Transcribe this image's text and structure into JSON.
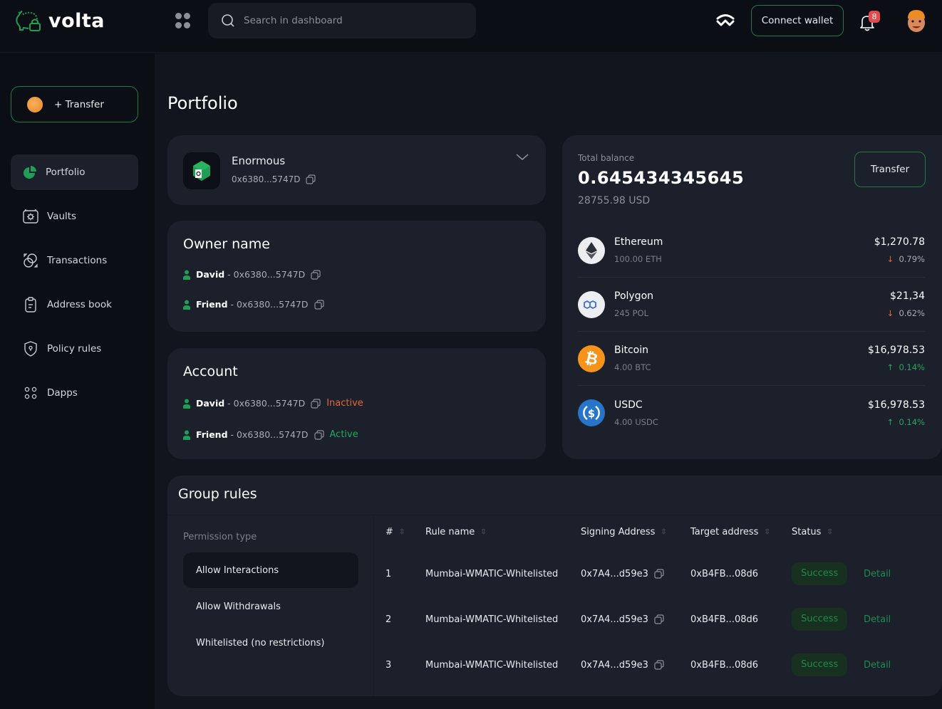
{
  "app": {
    "name": "volta"
  },
  "topbar": {
    "search_placeholder": "Search in dashboard",
    "connect_wallet_label": "Connect wallet",
    "notification_count": "8"
  },
  "sidebar": {
    "transfer_label": "+ Transfer",
    "items": [
      {
        "label": "Portfolio",
        "icon": "pie-chart-icon",
        "active": true
      },
      {
        "label": "Vaults",
        "icon": "vault-icon",
        "active": false
      },
      {
        "label": "Transactions",
        "icon": "transactions-icon",
        "active": false
      },
      {
        "label": "Address book",
        "icon": "clipboard-icon",
        "active": false
      },
      {
        "label": "Policy rules",
        "icon": "shield-icon",
        "active": false
      },
      {
        "label": "Dapps",
        "icon": "dots-grid-icon",
        "active": false
      }
    ]
  },
  "main": {
    "page_title": "Portfolio",
    "vault": {
      "name": "Enormous",
      "address": "0x6380...5747D"
    },
    "owners": {
      "title": "Owner name",
      "members": [
        {
          "name": "David",
          "address": "0x6380...5747D"
        },
        {
          "name": "Friend",
          "address": "0x6380...5747D"
        }
      ]
    },
    "account": {
      "title": "Account",
      "members": [
        {
          "name": "David",
          "address": "0x6380...5747D",
          "status": "Inactive"
        },
        {
          "name": "Friend",
          "address": "0x6380...5747D",
          "status": "Active"
        }
      ]
    },
    "balance": {
      "label": "Total balance",
      "value": "0.645434345645",
      "usd": "28755.98 USD",
      "transfer_label": "Transfer",
      "assets": [
        {
          "name": "Ethereum",
          "amount": "100.00 ETH",
          "usd": "$1,270.78",
          "change": "0.79%",
          "direction": "down",
          "icon": "ethereum-icon",
          "color": "#eceef2"
        },
        {
          "name": "Polygon",
          "amount": "245 POL",
          "usd": "$21,34",
          "change": "0.62%",
          "direction": "down",
          "icon": "polygon-icon",
          "color": "#eceef2"
        },
        {
          "name": "Bitcoin",
          "amount": "4.00 BTC",
          "usd": "$16,978.53",
          "change": "0.14%",
          "direction": "up",
          "icon": "bitcoin-icon",
          "color": "#f7931a"
        },
        {
          "name": "USDC",
          "amount": "4.00 USDC",
          "usd": "$16,978.53",
          "change": "0.14%",
          "direction": "up",
          "icon": "usdc-icon",
          "color": "#2775ca"
        }
      ]
    },
    "group_rules": {
      "title": "Group rules",
      "permission_label": "Permission type",
      "permission_types": [
        {
          "label": "Allow Interactions",
          "active": true
        },
        {
          "label": "Allow Withdrawals",
          "active": false
        },
        {
          "label": "Whitelisted (no restrictions)",
          "active": false
        }
      ],
      "columns": [
        "#",
        "Rule name",
        "Signing Address",
        "Target address",
        "Status"
      ],
      "rows": [
        {
          "num": "1",
          "rule": "Mumbai-WMATIC-Whitelisted",
          "signing": "0x7A4...d59e3",
          "target": "0xB4FB...08d6",
          "status": "Success",
          "action": "Detail"
        },
        {
          "num": "2",
          "rule": "Mumbai-WMATIC-Whitelisted",
          "signing": "0x7A4...d59e3",
          "target": "0xB4FB...08d6",
          "status": "Success",
          "action": "Detail"
        },
        {
          "num": "3",
          "rule": "Mumbai-WMATIC-Whitelisted",
          "signing": "0x7A4...d59e3",
          "target": "0xB4FB...08d6",
          "status": "Success",
          "action": "Detail"
        }
      ]
    }
  },
  "colors": {
    "accent_green": "#1f8a4c",
    "inactive_orange": "#e0683a",
    "active_green": "#25a55f",
    "badge_red": "#e5484d"
  }
}
